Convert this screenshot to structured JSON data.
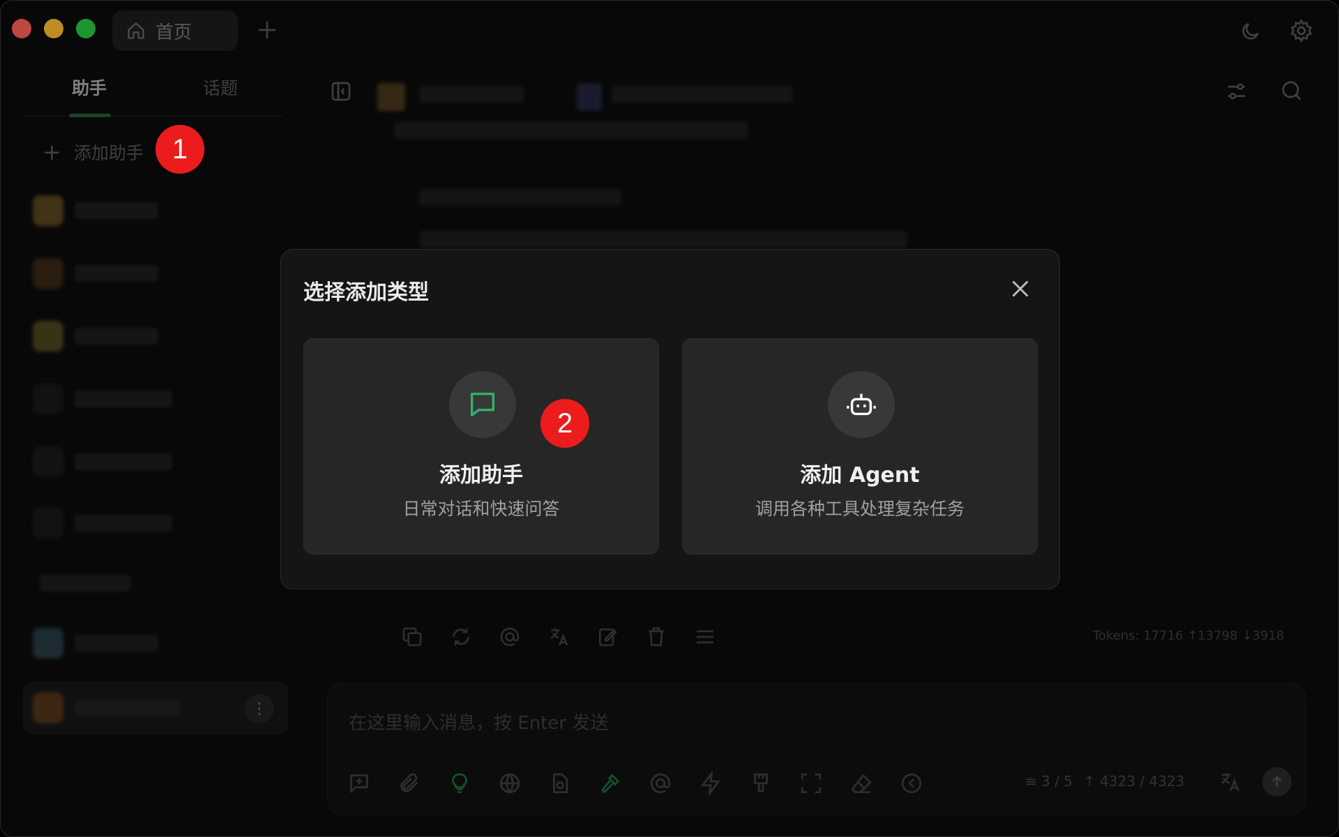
{
  "titlebar": {
    "home_tab_label": "首页"
  },
  "sidebar": {
    "tab_assistants": "助手",
    "tab_topics": "话题",
    "add_assistant_label": "添加助手"
  },
  "annotations": {
    "badge_1": "1",
    "badge_2": "2"
  },
  "message": {
    "tokens": "Tokens: 17716 ↑13798 ↓3918"
  },
  "input": {
    "placeholder": "在这里输入消息，按 Enter 发送",
    "context_count": "3 / 5",
    "token_count": "4323 / 4323"
  },
  "dialog": {
    "title": "选择添加类型",
    "options": [
      {
        "title": "添加助手",
        "description": "日常对话和快速问答",
        "icon": "chat-bubble-icon",
        "icon_color": "#2fb36b"
      },
      {
        "title": "添加 Agent",
        "description": "调用各种工具处理复杂任务",
        "icon": "robot-icon",
        "icon_color": "#ffffff"
      }
    ]
  },
  "colors": {
    "accent": "#2fb36b",
    "badge": "#ec1c1c"
  }
}
